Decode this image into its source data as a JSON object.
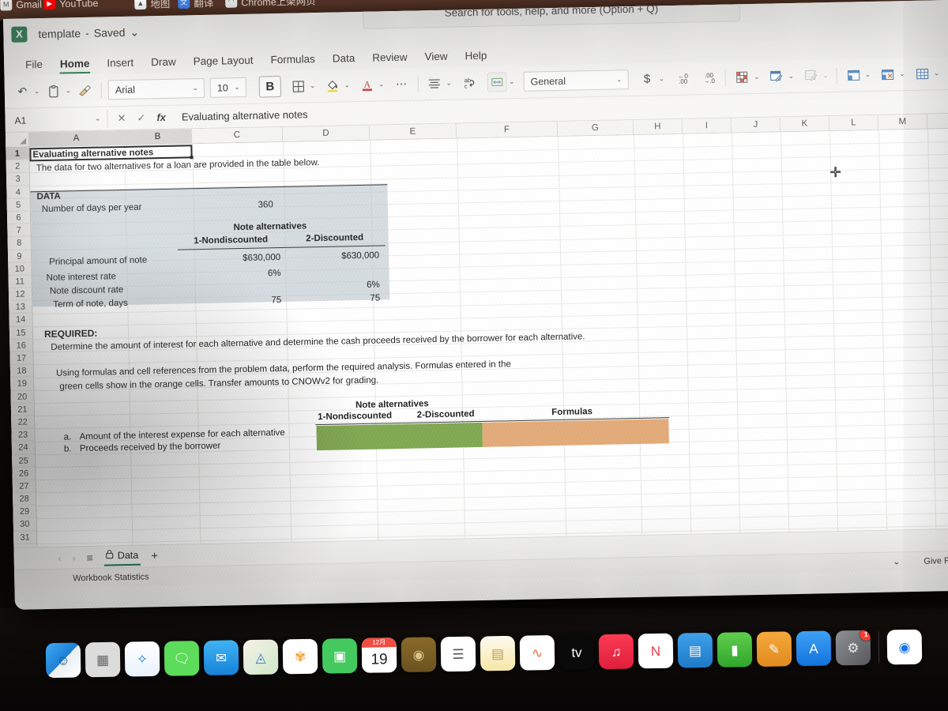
{
  "browser": {
    "bookmarks": [
      {
        "label": "Gmail",
        "icon": "gmail-icon",
        "color": "#e8e6e3",
        "glyph": "M"
      },
      {
        "label": "YouTube",
        "icon": "youtube-icon",
        "color": "#ff0000",
        "glyph": "▶"
      },
      {
        "label": "地图",
        "icon": "google-maps-icon",
        "color": "#ffffff",
        "glyph": "▲"
      },
      {
        "label": "翻译",
        "icon": "google-translate-icon",
        "color": "#4285f4",
        "glyph": "文"
      },
      {
        "label": "Chrome上架网页",
        "icon": "chrome-webstore-icon",
        "color": "#f2f2f2",
        "glyph": "◠"
      }
    ]
  },
  "app": {
    "logo": "excel-logo",
    "document_title": "template",
    "save_state": "Saved",
    "search_placeholder": "Search for tools, help, and more (Option + Q)",
    "tabs": [
      {
        "label": "File",
        "active": false
      },
      {
        "label": "Home",
        "active": true
      },
      {
        "label": "Insert",
        "active": false
      },
      {
        "label": "Draw",
        "active": false
      },
      {
        "label": "Page Layout",
        "active": false
      },
      {
        "label": "Formulas",
        "active": false
      },
      {
        "label": "Data",
        "active": false
      },
      {
        "label": "Review",
        "active": false
      },
      {
        "label": "View",
        "active": false
      },
      {
        "label": "Help",
        "active": false
      }
    ]
  },
  "ribbon": {
    "undo": "↶",
    "paste": "clipboard",
    "format_painter": "paintbrush",
    "font_name": "Arial",
    "font_size": "10",
    "bold_label": "B",
    "number_format": "General",
    "currency": "$",
    "decrease_decimal": "←0\n.00",
    "increase_decimal": ".00\n→.0",
    "more_label": "⋯"
  },
  "formula_bar": {
    "name_box": "A1",
    "cancel": "✕",
    "confirm": "✓",
    "fx": "fx",
    "content": "Evaluating alternative notes"
  },
  "grid": {
    "columns": [
      "A",
      "B",
      "C",
      "D",
      "E",
      "F",
      "G",
      "H",
      "I",
      "J",
      "K",
      "L",
      "M"
    ],
    "selected_columns": [
      "A",
      "B"
    ],
    "rows": [
      1,
      2,
      3,
      4,
      5,
      6,
      7,
      8,
      9,
      10,
      11,
      12,
      13,
      14,
      15,
      16,
      17,
      18,
      19,
      20,
      21,
      22,
      23,
      24,
      25,
      26,
      27,
      28,
      29,
      30,
      31
    ],
    "selected_row": 1,
    "active_cell": "A1",
    "colors": {
      "data_shade": "#b2bec7",
      "input_green": "#7fa64f",
      "formula_orange": "#e3a977",
      "accent_green": "#217346"
    },
    "cells": {
      "a1": "Evaluating alternative notes",
      "a2": "The data for two alternatives for a loan are provided in the table below.",
      "a4": "DATA",
      "a5": "Number of days per year",
      "c5": "360",
      "c7_header": "Note alternatives",
      "c8_col1": "1-Nondiscounted",
      "d8_col2": "2-Discounted",
      "a9": "Principal amount of note",
      "c9": "$630,000",
      "d9": "$630,000",
      "a10": "Note interest rate",
      "c10": "6%",
      "a11": "Note discount rate",
      "d11": "6%",
      "a12": "Term of note, days",
      "c12": "75",
      "d12": "75",
      "a14": "REQUIRED:",
      "a15": "Determine the amount of interest for each alternative and determine the cash proceeds received by the borrower for each alternative.",
      "a17_line1": "Using formulas and cell references from the problem data, perform the required analysis. Formulas entered in the",
      "a17_line2": "green cells show in the orange cells. Transfer amounts to CNOWv2 for grading.",
      "c19_header": "Note alternatives",
      "c20_col1": "1-Nondiscounted",
      "d20_col2": "2-Discounted",
      "f20_formulas": "Formulas",
      "a21_letter": "a.",
      "a21": "Amount of the interest expense for each alternative",
      "a22_letter": "b.",
      "a22": "Proceeds received by the borrower"
    }
  },
  "sheet_bar": {
    "prev": "‹",
    "next": "›",
    "all_sheets": "≡",
    "tab_name": "Data",
    "tab_locked_icon": "lock-icon",
    "add_sheet": "+"
  },
  "status_bar": {
    "workbook_statistics": "Workbook Statistics",
    "zoom_caret": "⌄",
    "feedback": "Give Fee"
  },
  "dock": {
    "items": [
      {
        "name": "finder",
        "glyph": "☺",
        "bg": "linear-gradient(135deg,#3ea8f5 0%,#1f7fd4 50%,#e9eef2 50%,#ffffff 100%)",
        "color": "#1a4f80"
      },
      {
        "name": "launchpad",
        "glyph": "▦",
        "bg": "#dcdcdc",
        "color": "#666"
      },
      {
        "name": "safari",
        "glyph": "✧",
        "bg": "linear-gradient(180deg,#ffffff,#e8f2fb)",
        "color": "#1a7fe0"
      },
      {
        "name": "messages",
        "glyph": "🗨",
        "bg": "#5ddb5a",
        "color": "#fff"
      },
      {
        "name": "mail",
        "glyph": "✉",
        "bg": "linear-gradient(180deg,#3fb4f5,#1781d8)",
        "color": "#fff"
      },
      {
        "name": "maps",
        "glyph": "◬",
        "bg": "linear-gradient(135deg,#f5f1e6,#cfe8c9)",
        "color": "#3a7fd5"
      },
      {
        "name": "photos",
        "glyph": "✾",
        "bg": "#ffffff",
        "color": "#f3a33c"
      },
      {
        "name": "facetime",
        "glyph": "▣",
        "bg": "#44c95f",
        "color": "#fff"
      },
      {
        "name": "calendar",
        "glyph": "",
        "bg": "#ffffff",
        "color": "#222",
        "month": "12月",
        "day": "19"
      },
      {
        "name": "podcasts",
        "glyph": "◉",
        "bg": "linear-gradient(180deg,#8a6a2a,#6b5220)",
        "color": "#d8c28a"
      },
      {
        "name": "reminders",
        "glyph": "☰",
        "bg": "#ffffff",
        "color": "#555"
      },
      {
        "name": "notes",
        "glyph": "▤",
        "bg": "linear-gradient(180deg,#fdfaf0,#f6e7a6)",
        "color": "#b9a25a"
      },
      {
        "name": "freeform",
        "glyph": "∿",
        "bg": "#ffffff",
        "color": "#ef6a3c"
      },
      {
        "name": "apple-tv",
        "glyph": "tv",
        "bg": "#0a0a0a",
        "color": "#fff"
      },
      {
        "name": "music",
        "glyph": "♫",
        "bg": "linear-gradient(180deg,#fb3a53,#e01f3d)",
        "color": "#fff"
      },
      {
        "name": "news",
        "glyph": "N",
        "bg": "#ffffff",
        "color": "#ef3b4a"
      },
      {
        "name": "keynote",
        "glyph": "▤",
        "bg": "linear-gradient(180deg,#3fa0e8,#1e7ac8)",
        "color": "#fff"
      },
      {
        "name": "numbers",
        "glyph": "▮",
        "bg": "linear-gradient(180deg,#5fce4e,#31a62b)",
        "color": "#fff"
      },
      {
        "name": "pages",
        "glyph": "✎",
        "bg": "linear-gradient(180deg,#f6a93b,#e08a20)",
        "color": "#fff"
      },
      {
        "name": "app-store",
        "glyph": "A",
        "bg": "linear-gradient(180deg,#3fa0f5,#1274dd)",
        "color": "#fff"
      },
      {
        "name": "system-settings",
        "glyph": "⚙",
        "bg": "linear-gradient(135deg,#8e9094,#56585c)",
        "color": "#e8e8e8",
        "badge": "1"
      },
      {
        "name": "google-chrome",
        "glyph": "◉",
        "bg": "#ffffff",
        "color": "#1a73e8"
      }
    ]
  }
}
